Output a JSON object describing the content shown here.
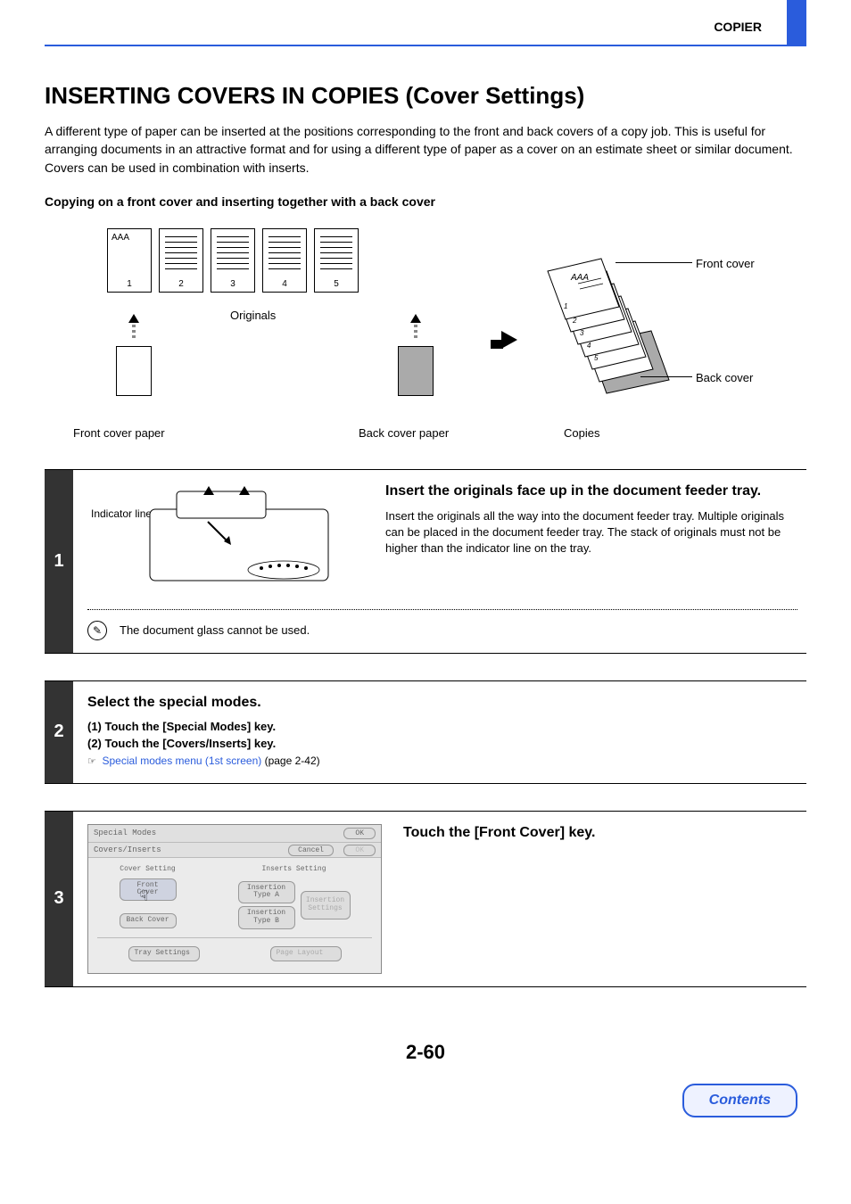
{
  "header": {
    "section": "COPIER"
  },
  "title": "INSERTING COVERS IN COPIES (Cover Settings)",
  "intro": {
    "p1": "A different type of paper can be inserted at the positions corresponding to the front and back covers of a copy job. This is useful for arranging documents in an attractive format and for using a different type of paper as a cover on an estimate sheet or similar document.",
    "p2": "Covers can be used in combination with inserts."
  },
  "subhead": "Copying on a front cover and inserting together with a back cover",
  "diagram": {
    "page_title_text": "AAA",
    "page_numbers": [
      "1",
      "2",
      "3",
      "4",
      "5"
    ],
    "originals_label": "Originals",
    "front_paper_label": "Front cover paper",
    "back_paper_label": "Back cover paper",
    "front_cover_label": "Front cover",
    "back_cover_label": "Back cover",
    "copies_label": "Copies",
    "stack_text": "AAA",
    "stack_nums": [
      "1",
      "2",
      "3",
      "4",
      "5"
    ]
  },
  "step1": {
    "num": "1",
    "indicator_label": "Indicator line",
    "title": "Insert the originals face up in the document feeder tray.",
    "desc": "Insert the originals all the way into the document feeder tray. Multiple originals can be placed in the document feeder tray. The stack of originals must not be higher than the indicator line on the tray.",
    "note": "The document glass cannot be used."
  },
  "step2": {
    "num": "2",
    "title": "Select the special modes.",
    "sub1": "(1)   Touch the [Special Modes] key.",
    "sub2": "(2)   Touch the [Covers/Inserts] key.",
    "link_text": "Special modes menu (1st screen)",
    "link_suffix": " (page 2-42)"
  },
  "step3": {
    "num": "3",
    "title": "Touch the [Front Cover] key.",
    "panel": {
      "row1_left": "Special Modes",
      "row1_ok": "OK",
      "row2_left": "Covers/Inserts",
      "row2_cancel": "Cancel",
      "row2_ok": "OK",
      "col1_title": "Cover Setting",
      "col2_title": "Inserts Setting",
      "btn_front": "Front Cover",
      "btn_back": "Back Cover",
      "btn_ins_a": "Insertion Type A",
      "btn_ins_b": "Insertion Type B",
      "btn_ins_set": "Insertion Settings",
      "btn_tray": "Tray Settings",
      "btn_layout": "Page Layout"
    }
  },
  "footer": {
    "page_num": "2-60",
    "contents": "Contents"
  }
}
